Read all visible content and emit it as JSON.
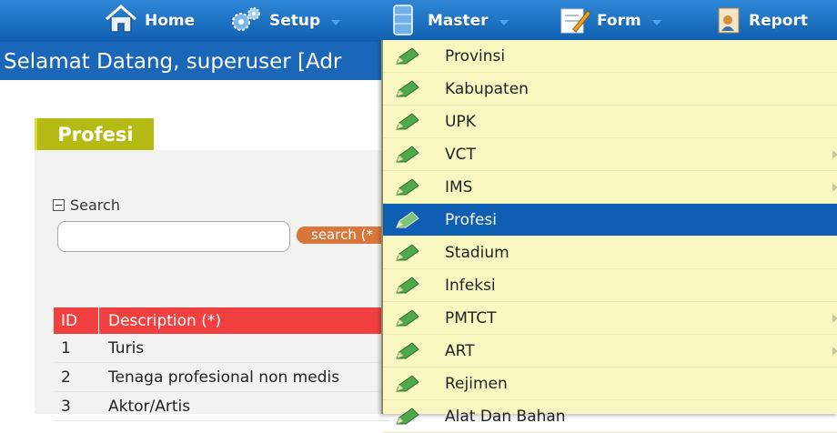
{
  "nav": {
    "items": [
      {
        "label": "Home",
        "icon": "home-icon",
        "has_caret": false
      },
      {
        "label": "Setup",
        "icon": "gears-icon",
        "has_caret": true
      },
      {
        "label": "Master",
        "icon": "database-icon",
        "has_caret": true
      },
      {
        "label": "Form",
        "icon": "form-icon",
        "has_caret": true
      },
      {
        "label": "Report",
        "icon": "report-icon",
        "has_caret": false
      }
    ]
  },
  "welcome": {
    "text": "Selamat Datang, superuser [Adr"
  },
  "page": {
    "title": "Profesi"
  },
  "search": {
    "toggle_label": "Search",
    "input_value": "",
    "button_label": "search (*"
  },
  "table": {
    "headers": [
      "ID",
      "Description  (*)"
    ],
    "rows": [
      {
        "id": "1",
        "description": "Turis"
      },
      {
        "id": "2",
        "description": "Tenaga profesional non medis"
      },
      {
        "id": "3",
        "description": "Aktor/Artis"
      }
    ]
  },
  "menu": {
    "items": [
      {
        "label": "Provinsi",
        "submenu": false,
        "active": false
      },
      {
        "label": "Kabupaten",
        "submenu": false,
        "active": false
      },
      {
        "label": "UPK",
        "submenu": false,
        "active": false
      },
      {
        "label": "VCT",
        "submenu": true,
        "active": false
      },
      {
        "label": "IMS",
        "submenu": true,
        "active": false
      },
      {
        "label": "Profesi",
        "submenu": false,
        "active": true
      },
      {
        "label": "Stadium",
        "submenu": false,
        "active": false
      },
      {
        "label": "Infeksi",
        "submenu": false,
        "active": false
      },
      {
        "label": "PMTCT",
        "submenu": true,
        "active": false
      },
      {
        "label": "ART",
        "submenu": true,
        "active": false
      },
      {
        "label": "Rejimen",
        "submenu": false,
        "active": false
      },
      {
        "label": "Alat Dan Bahan",
        "submenu": false,
        "active": false
      }
    ]
  },
  "colors": {
    "nav_bar": "#1a6fc4",
    "menu_bg": "#f8f8c0",
    "menu_active": "#0e5fb4",
    "title_tab": "#b6ba14",
    "table_header": "#f24040",
    "search_button": "#d9773a"
  }
}
